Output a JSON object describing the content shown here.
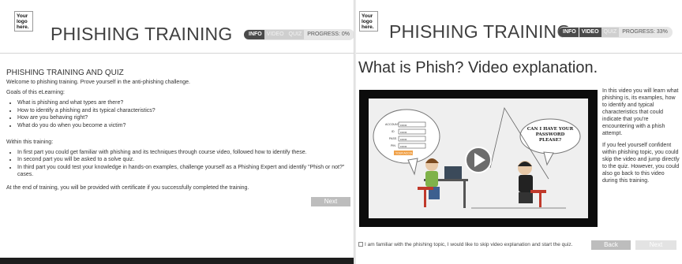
{
  "logo": {
    "lines": [
      "Your",
      "logo",
      "here."
    ]
  },
  "left": {
    "title": "PHISHING TRAINING",
    "progress": {
      "tabs": [
        "INFO",
        "VIDEO",
        "QUIZ"
      ],
      "active": "INFO",
      "label": "PROGRESS: 0%",
      "value_percent": 0
    },
    "heading": "PHISHING TRAINING AND QUIZ",
    "intro": "Welcome to phishing training. Prove yourself in the anti-phishing challenge.",
    "goals_heading": "Goals of this eLearning:",
    "goals": [
      "What is phishing and what types are there?",
      "How to identify a phishing and its typical characteristics?",
      "How are you behaving right?",
      "What do you do when you become a victim?"
    ],
    "within_heading": "Within this training:",
    "within": [
      "In first part you could get familiar with phishing and its techniques through course video, followed how to identify these.",
      "In second part you will be asked to a solve quiz.",
      "In third part you could test your knowledge in hands-on examples, challenge yourself as a Phishing Expert and identify \"Phish or not?\" cases."
    ],
    "closing": "At the end of training, you will be provided with certificate if you successfully completed the training.",
    "next_label": "Next"
  },
  "right": {
    "title": "PHISHING TRAINING",
    "progress": {
      "tabs": [
        "INFO",
        "VIDEO",
        "QUIZ"
      ],
      "active": "VIDEO",
      "label": "PROGRESS: 33%",
      "value_percent": 33
    },
    "heading": "What is Phish? Video explanation.",
    "video": {
      "speech": "CAN I HAVE YOUR PASSWORD PLEASE?",
      "form_fields": [
        "ACCOUNT #",
        "ID",
        "PASS",
        "PIN"
      ],
      "form_mask": "••••••",
      "form_button": "YOUR ACCOUNT"
    },
    "side_text": [
      "In this video you will learn what phishing is, its examples, how to identify and typical characteristics that could indicate that you're encountering with a phish attempt.",
      "If you feel yourself confident within phishing topic, you could skip the video and jump directly to the quiz. However, you could also go back to this video during this training."
    ],
    "skip_label": "I am familiar with the phishing topic, I would like to skip video explanation and start the quiz.",
    "back_label": "Back",
    "next_label": "Next"
  },
  "colors": {
    "button": "#bdbdbd",
    "progress_active": "#4a4a4a",
    "progress_inactive": "#cfcfcf",
    "video_bg": "#0c0c0c"
  }
}
